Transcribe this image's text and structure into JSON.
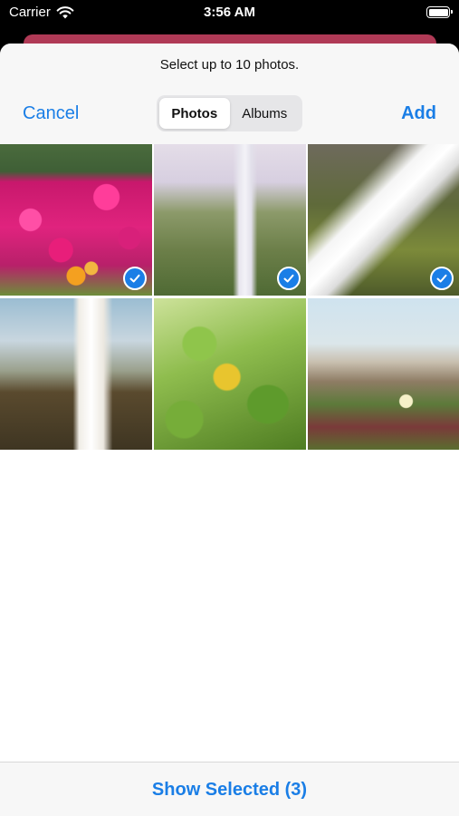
{
  "status_bar": {
    "carrier": "Carrier",
    "time": "3:56 AM"
  },
  "picker": {
    "prompt": "Select up to 10 photos.",
    "cancel_label": "Cancel",
    "add_label": "Add",
    "tabs": [
      {
        "label": "Photos",
        "selected": true
      },
      {
        "label": "Albums",
        "selected": false
      }
    ],
    "photos": [
      {
        "subject": "pink flowers",
        "selected": true
      },
      {
        "subject": "waterfall mist",
        "selected": true
      },
      {
        "subject": "cascading water",
        "selected": true
      },
      {
        "subject": "waterfall cliff",
        "selected": false
      },
      {
        "subject": "yellow leaf",
        "selected": false
      },
      {
        "subject": "coastal meadow",
        "selected": false
      }
    ],
    "show_selected_label": "Show Selected (3)"
  },
  "colors": {
    "accent": "#1a7ee6",
    "sheet_background": "#ffffff",
    "bar_background": "#f7f7f7",
    "underlying_sheet": "#b03a56"
  }
}
